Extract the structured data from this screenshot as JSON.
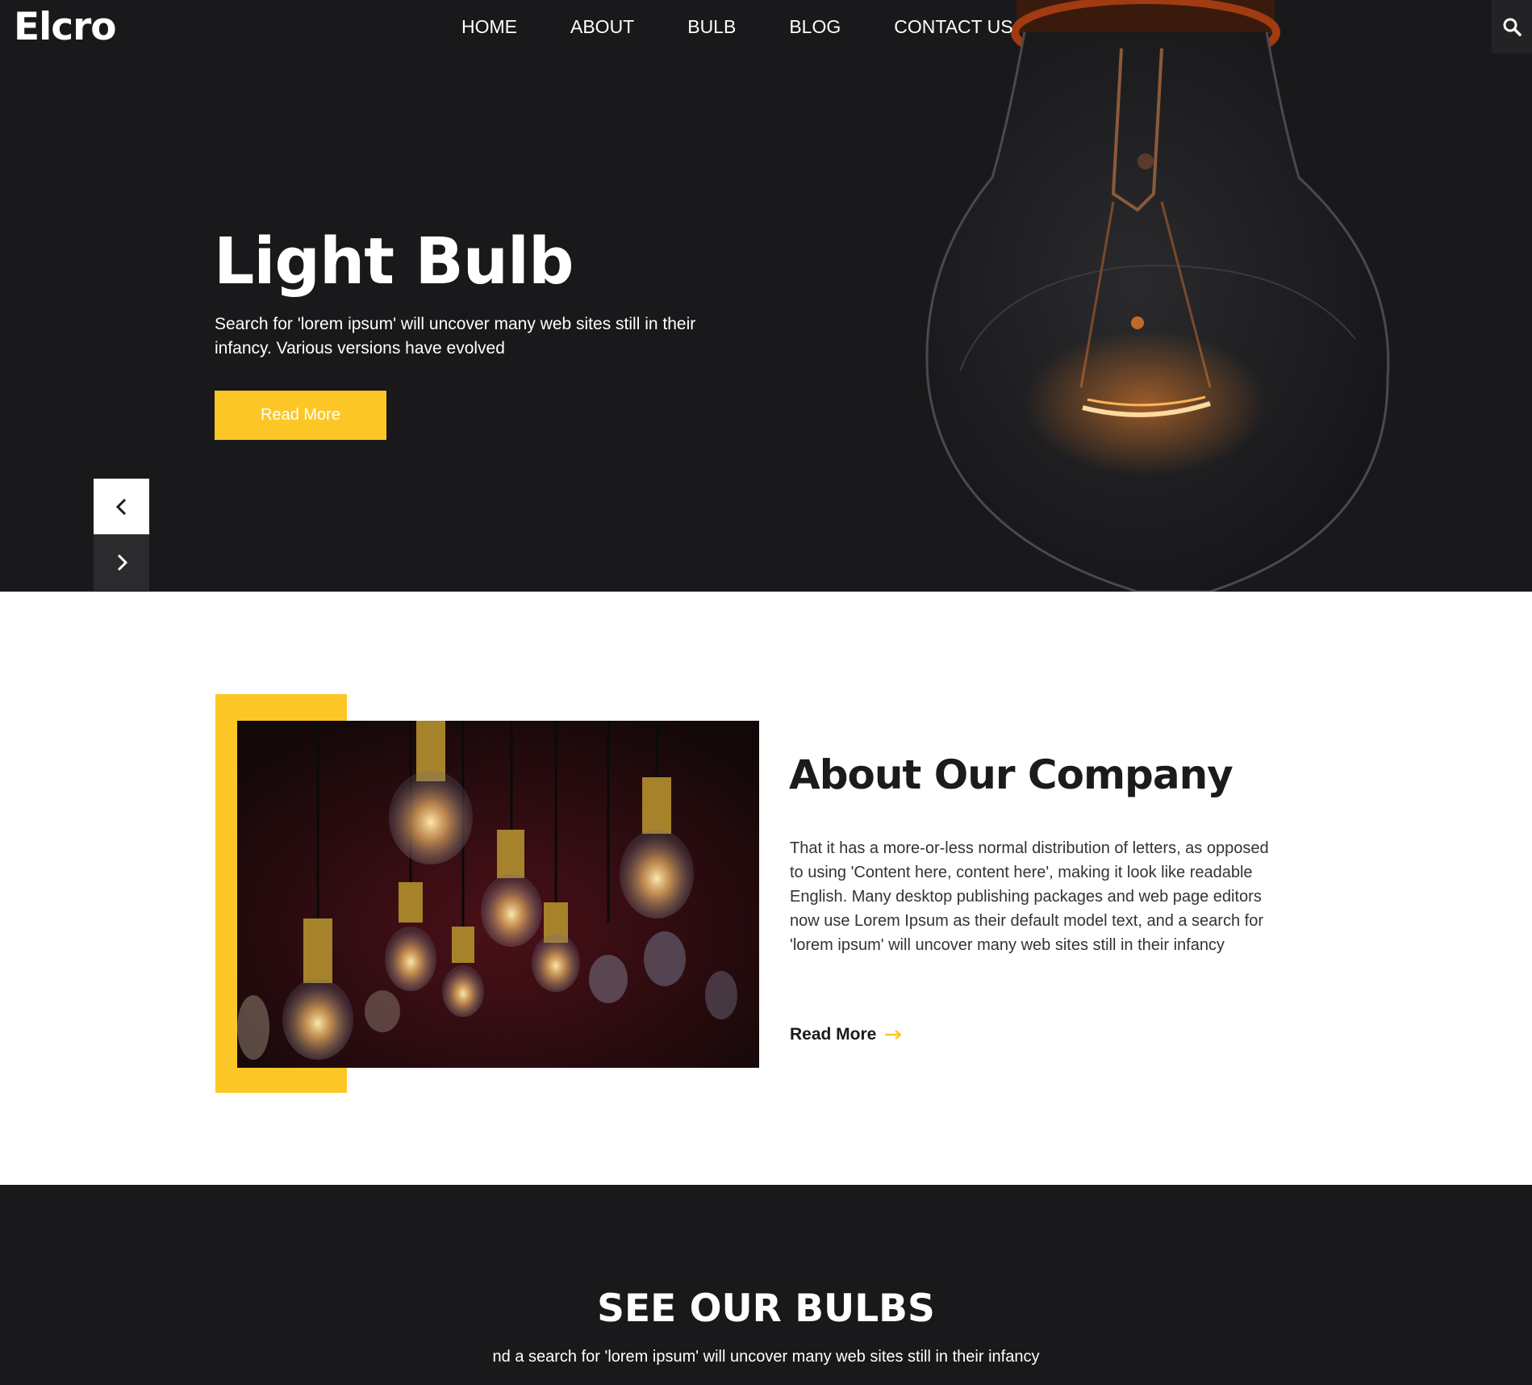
{
  "brand": {
    "logo": "Elcro"
  },
  "nav": {
    "items": [
      {
        "label": "HOME"
      },
      {
        "label": "ABOUT"
      },
      {
        "label": "BULB"
      },
      {
        "label": "BLOG"
      },
      {
        "label": "CONTACT US"
      }
    ],
    "search_icon": "search-icon"
  },
  "hero": {
    "title": "Light Bulb",
    "text": "Search for 'lorem ipsum' will uncover many web sites still in their infancy. Various versions have evolved",
    "button_label": "Read More",
    "prev_icon": "chevron-left-icon",
    "next_icon": "chevron-right-icon"
  },
  "about": {
    "title": "About Our Company",
    "text": "That it has a more-or-less normal distribution of letters, as opposed to using 'Content here, content here', making it look like readable English. Many desktop publishing packages and web page editors now use Lorem Ipsum as their default model text, and a search for 'lorem ipsum' will uncover many web sites still in their infancy",
    "link_label": "Read More",
    "link_icon": "arrow-right-icon"
  },
  "bulbs_section": {
    "title": "SEE OUR BULBS",
    "text": "nd a search for 'lorem ipsum' will uncover many web sites still in their infancy"
  },
  "colors": {
    "accent": "#fcc726",
    "dark_bg": "#19191b",
    "text_dark": "#1b1b1d",
    "white": "#ffffff"
  }
}
